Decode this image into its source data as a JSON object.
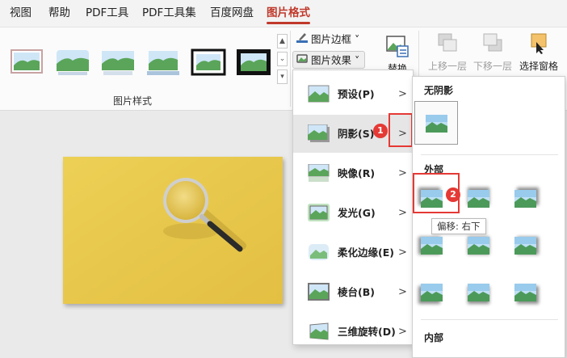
{
  "tabs": [
    {
      "label": "视图"
    },
    {
      "label": "帮助"
    },
    {
      "label": "PDF工具"
    },
    {
      "label": "PDF工具集"
    },
    {
      "label": "百度网盘"
    },
    {
      "label": "图片格式",
      "active": true
    }
  ],
  "ribbon": {
    "picture_styles_label": "图片样式",
    "picture_border": "图片边框",
    "picture_effects": "图片效果",
    "replace": "替换",
    "bring_forward": "上移一层",
    "send_backward": "下移一层",
    "selection_pane": "选择窗格"
  },
  "effects_menu": [
    {
      "label": "预设(P)"
    },
    {
      "label": "阴影(S)"
    },
    {
      "label": "映像(R)"
    },
    {
      "label": "发光(G)"
    },
    {
      "label": "柔化边缘(E)"
    },
    {
      "label": "棱台(B)"
    },
    {
      "label": "三维旋转(D)"
    }
  ],
  "shadow_submenu": {
    "no_shadow": "无阴影",
    "outer": "外部",
    "inner": "内部",
    "tooltip": "偏移: 右下"
  },
  "markers": {
    "step1": "1",
    "step2": "2"
  },
  "colors": {
    "accent": "#c0392b",
    "marker": "#e53935",
    "photo_bg": "#e8c64a"
  }
}
